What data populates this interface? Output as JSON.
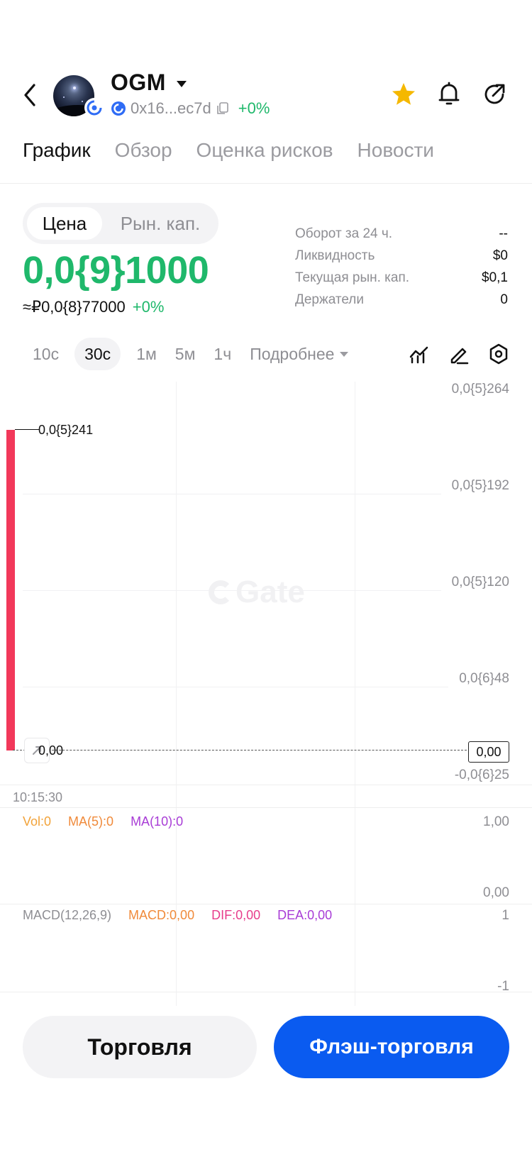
{
  "header": {
    "token_name": "OGM",
    "address": "0x16...ec7d",
    "change": "+0%"
  },
  "tabs": [
    "График",
    "Обзор",
    "Оценка рисков",
    "Новости"
  ],
  "price_toggle": {
    "price": "Цена",
    "market_cap": "Рын. кап."
  },
  "price": {
    "main": "0,0{9}1000",
    "fiat": "≈₽0,0{8}77000",
    "change": "+0%"
  },
  "stats": [
    {
      "label": "Оборот за 24 ч.",
      "value": "--"
    },
    {
      "label": "Ликвидность",
      "value": "$0"
    },
    {
      "label": "Текущая рын. кап.",
      "value": "$0,1"
    },
    {
      "label": "Держатели",
      "value": "0"
    }
  ],
  "intervals": [
    "10с",
    "30с",
    "1м",
    "5м",
    "1ч"
  ],
  "intervals_selected": "30с",
  "intervals_more": "Подробнее",
  "chart": {
    "y_labels": [
      "0,0{5}264",
      "0,0{5}192",
      "0,0{5}120",
      "0,0{6}48",
      "-0,0{6}25"
    ],
    "high_label": "0,0{5}241",
    "zero_label": "0,00",
    "current_price_tag": "0,00",
    "time_label": "10:15:30",
    "watermark": "Gate"
  },
  "volume": {
    "vol": "Vol:0",
    "ma5": "MA(5):0",
    "ma10": "MA(10):0",
    "top": "1,00",
    "bottom": "0,00"
  },
  "macd": {
    "label": "MACD(12,26,9)",
    "macd": "MACD:0,00",
    "dif": "DIF:0,00",
    "dea": "DEA:0,00",
    "top": "1",
    "bottom": "-1"
  },
  "buttons": {
    "trade": "Торговля",
    "flash": "Флэш-торговля"
  },
  "colors": {
    "green": "#1fb86b",
    "red": "#f2385a",
    "blue": "#0a5bf0",
    "star": "#f5b800"
  },
  "icons": {
    "back": "chevron-left-icon",
    "favorite": "star-icon",
    "alert": "bell-icon",
    "share": "share-icon",
    "indicator": "indicator-icon",
    "draw": "pen-icon",
    "settings": "settings-hex-icon"
  }
}
